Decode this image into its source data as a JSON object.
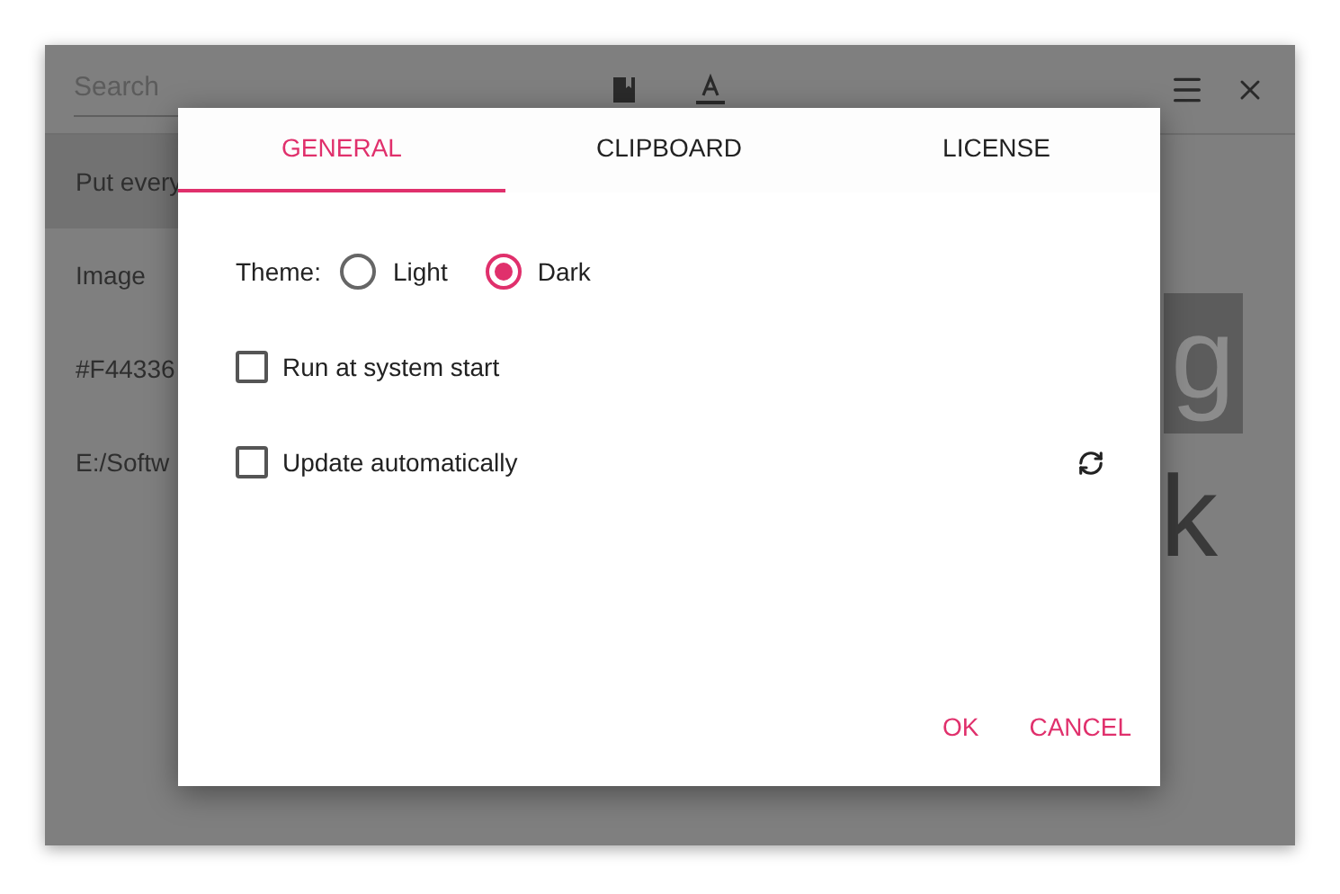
{
  "background_window": {
    "search": {
      "placeholder": "Search"
    },
    "items": [
      {
        "label": "Put every",
        "selected": true
      },
      {
        "label": "Image",
        "selected": false
      },
      {
        "label": "#F44336",
        "selected": false
      },
      {
        "label": "E:/Softw",
        "selected": false
      }
    ],
    "preview": [
      {
        "text": "g",
        "highlighted": true
      },
      {
        "text": "k",
        "highlighted": false
      }
    ]
  },
  "dialog": {
    "tabs": [
      {
        "label": "GENERAL",
        "selected": true
      },
      {
        "label": "CLIPBOARD",
        "selected": false
      },
      {
        "label": "LICENSE",
        "selected": false
      }
    ],
    "theme": {
      "label": "Theme:",
      "options": [
        {
          "label": "Light",
          "selected": false
        },
        {
          "label": "Dark",
          "selected": true
        }
      ]
    },
    "options": [
      {
        "label": "Run at system start",
        "checked": false
      },
      {
        "label": "Update automatically",
        "checked": false
      }
    ],
    "buttons": [
      "OK",
      "CANCEL"
    ]
  }
}
